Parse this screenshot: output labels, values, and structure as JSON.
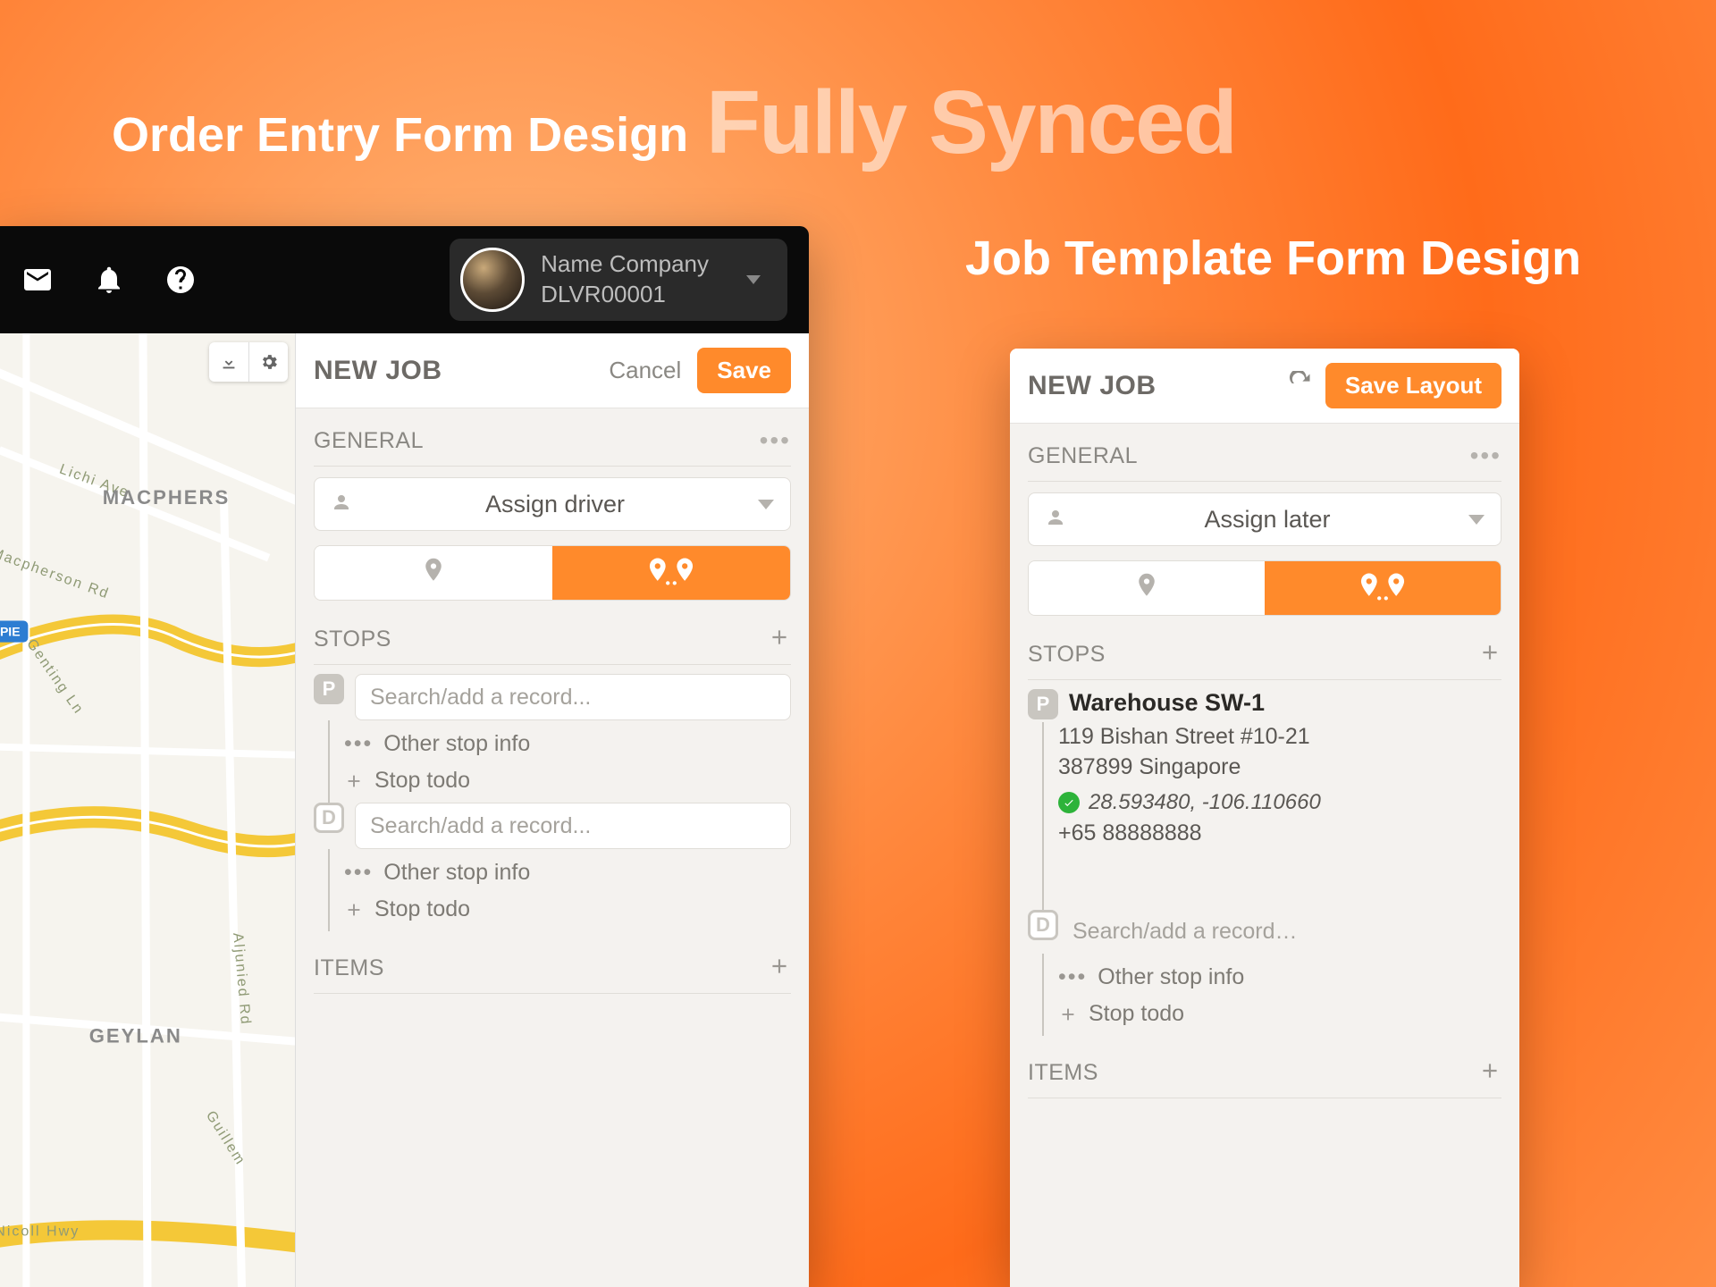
{
  "headings": {
    "left": "Order Entry Form Design",
    "main": "Fully Synced",
    "right": "Job Template Form Design"
  },
  "topbar": {
    "company_name": "Name Company",
    "company_id": "DLVR00001"
  },
  "left_form": {
    "title": "NEW JOB",
    "cancel": "Cancel",
    "save": "Save",
    "sections": {
      "general": "GENERAL",
      "stops": "STOPS",
      "items": "ITEMS"
    },
    "assign_label": "Assign driver",
    "stop_p_placeholder": "Search/add a record...",
    "stop_d_placeholder": "Search/add a record...",
    "other_stop_info": "Other stop info",
    "stop_todo": "Stop todo"
  },
  "right_form": {
    "title": "NEW JOB",
    "save": "Save Layout",
    "sections": {
      "general": "GENERAL",
      "stops": "STOPS",
      "items": "ITEMS"
    },
    "assign_label": "Assign later",
    "pickup": {
      "name": "Warehouse SW-1",
      "addr1": "119 Bishan Street #10-21",
      "addr2": "387899 Singapore",
      "coords": "28.593480, -106.110660",
      "phone": "+65 88888888"
    },
    "stop_d_placeholder": "Search/add a record…",
    "other_stop_info": "Other stop info",
    "stop_todo": "Stop todo"
  },
  "map_labels": {
    "macpherson": "MACPHERSON",
    "geylang": "GEYLANG",
    "lichi": "Lichi Ave",
    "macpherson_rd": "Macpherson Rd",
    "genting": "Genting Ln",
    "aljunied": "Aljunied Rd",
    "guillem": "Guillem",
    "nicoll": "Nicoll Hwy",
    "pie": "PIE"
  }
}
